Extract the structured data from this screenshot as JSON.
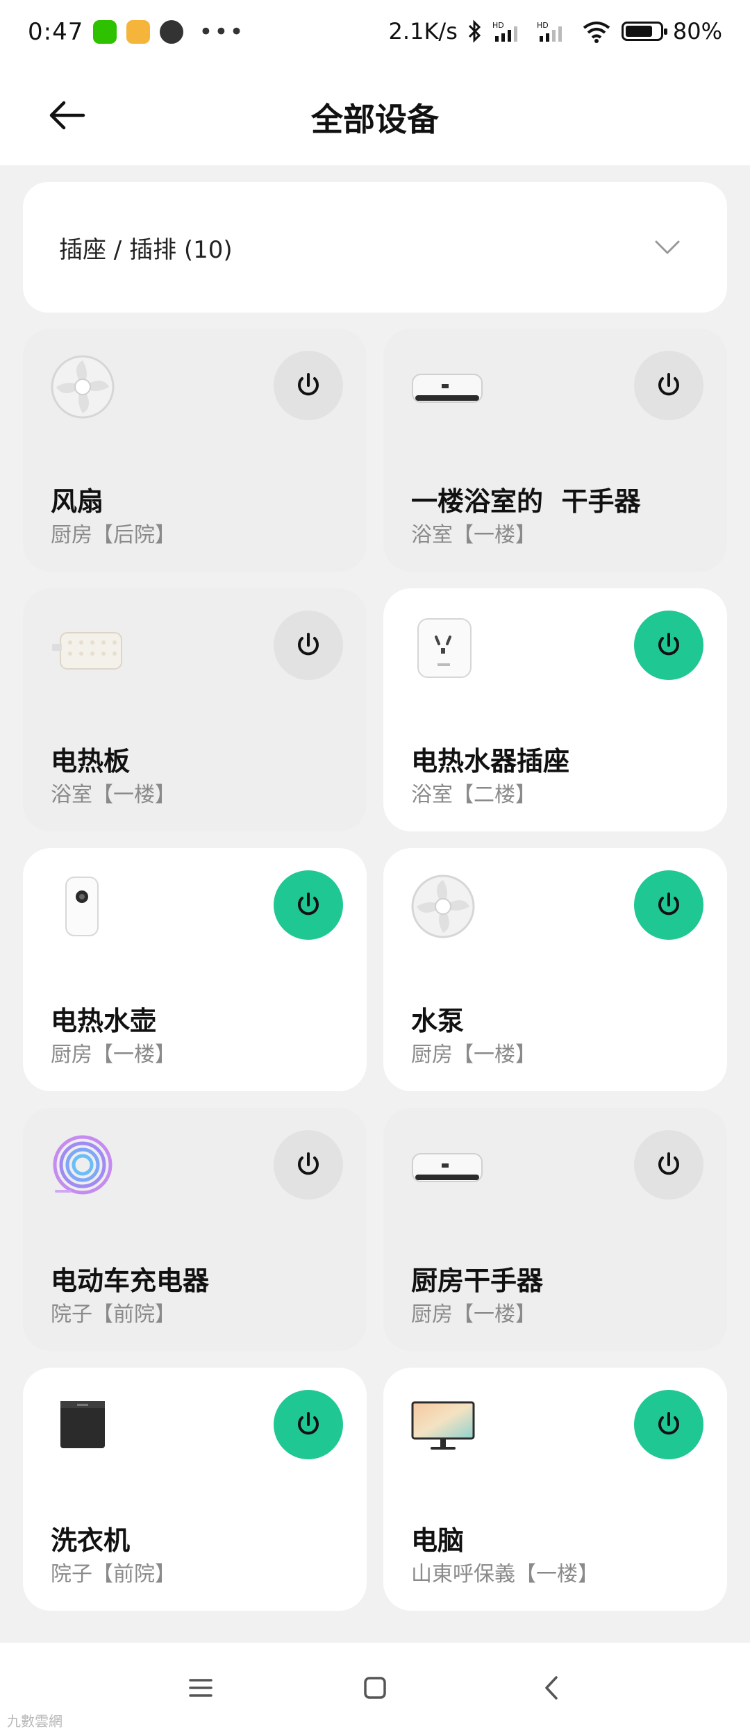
{
  "status": {
    "time": "0:47",
    "dots": "•••",
    "speed": "2.1K/s",
    "battery": "80%",
    "battery_level": 0.8
  },
  "header": {
    "title": "全部设备"
  },
  "filter": {
    "label": "插座 / 插排 (10)"
  },
  "devices": [
    {
      "name": "风扇",
      "room": "厨房【后院】",
      "on": false,
      "icon": "fan-icon"
    },
    {
      "name": "一楼浴室的  干手器",
      "room": "浴室【一楼】",
      "on": false,
      "icon": "water-heater-icon"
    },
    {
      "name": "电热板",
      "room": "浴室【一楼】",
      "on": false,
      "icon": "heating-pad-icon"
    },
    {
      "name": "电热水器插座",
      "room": "浴室【二楼】",
      "on": true,
      "icon": "smart-plug-icon"
    },
    {
      "name": "电热水壶",
      "room": "厨房【一楼】",
      "on": true,
      "icon": "kettle-icon"
    },
    {
      "name": "水泵",
      "room": "厨房【一楼】",
      "on": true,
      "icon": "fan-icon"
    },
    {
      "name": "电动车充电器",
      "room": "院子【前院】",
      "on": false,
      "icon": "led-coil-icon"
    },
    {
      "name": "厨房干手器",
      "room": "厨房【一楼】",
      "on": false,
      "icon": "water-heater-icon"
    },
    {
      "name": "洗衣机",
      "room": "院子【前院】",
      "on": true,
      "icon": "washing-machine-icon"
    },
    {
      "name": "电脑",
      "room": "山東呼保義【一楼】",
      "on": true,
      "icon": "monitor-icon"
    }
  ],
  "colors": {
    "accent": "#1fc793",
    "off_button": "#e2e2e2"
  },
  "watermark": "九數雲網"
}
